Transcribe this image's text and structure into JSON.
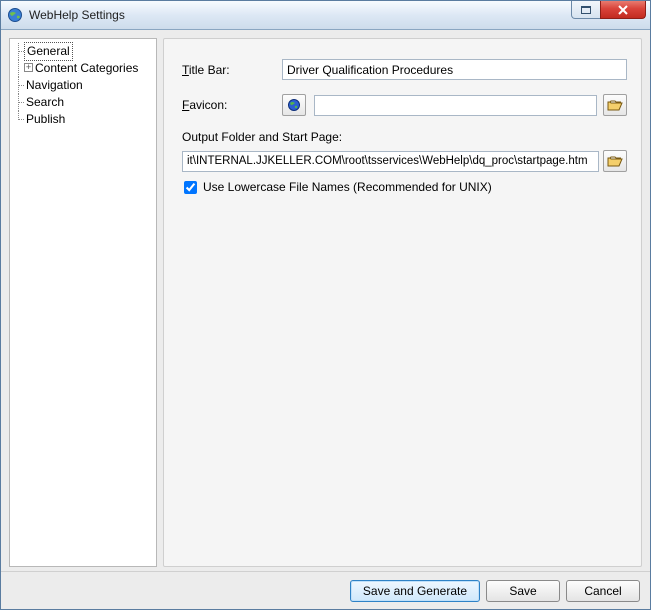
{
  "window": {
    "title": "WebHelp Settings"
  },
  "tree": {
    "items": [
      {
        "label": "General",
        "expander": null,
        "selected": true
      },
      {
        "label": "Content Categories",
        "expander": "+",
        "selected": false
      },
      {
        "label": "Navigation",
        "expander": null,
        "selected": false
      },
      {
        "label": "Search",
        "expander": null,
        "selected": false
      },
      {
        "label": "Publish",
        "expander": null,
        "selected": false
      }
    ]
  },
  "form": {
    "title_bar_label_pre": "",
    "title_bar_label_ul": "T",
    "title_bar_label_post": "itle Bar:",
    "title_bar_value": "Driver Qualification Procedures",
    "favicon_label_ul": "F",
    "favicon_label_post": "avicon:",
    "favicon_value": "",
    "output_label_ul": "O",
    "output_label_post": "utput Folder and Start Page:",
    "output_value": "it\\INTERNAL.JJKELLER.COM\\root\\tsservices\\WebHelp\\dq_proc\\startpage.htm",
    "lowercase_label_ul": "U",
    "lowercase_label_post": "se Lowercase File Names (Recommended for UNIX)",
    "lowercase_checked": true
  },
  "footer": {
    "save_generate": "Save and Generate",
    "save": "Save",
    "cancel": "Cancel"
  }
}
